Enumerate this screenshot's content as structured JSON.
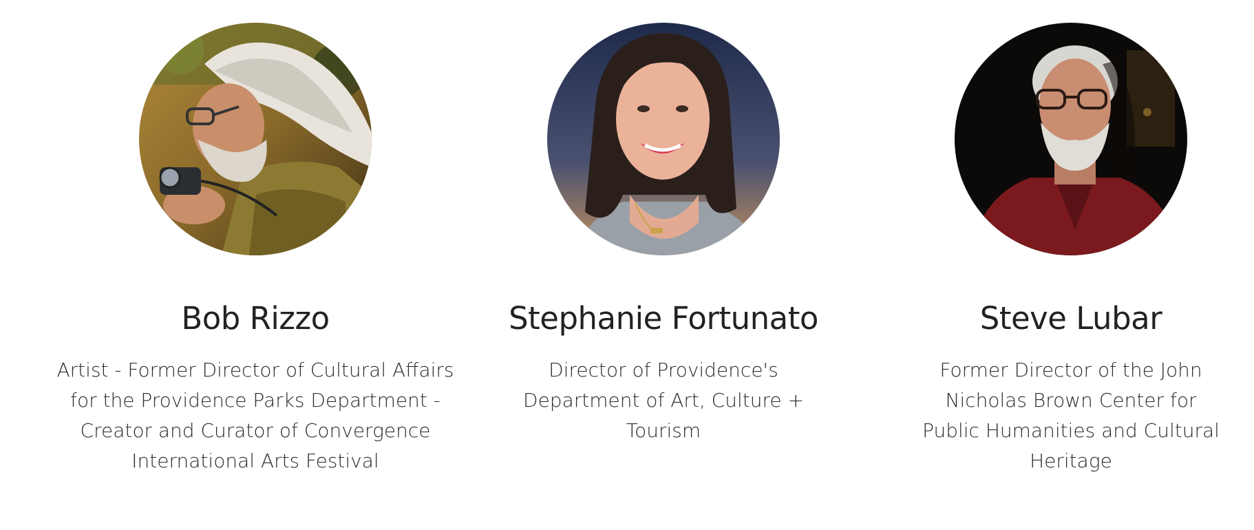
{
  "members": [
    {
      "name": "Bob Rizzo",
      "role_lines": [
        "Artist - Former Director of Cultural Affairs",
        "for the Providence Parks Department -",
        "Creator and Curator of Convergence",
        "International Arts Festival"
      ],
      "photo_icon": "portrait-photo"
    },
    {
      "name": "Stephanie Fortunato",
      "role_lines": [
        "Director of Providence's",
        "Department of Art, Culture +",
        "Tourism"
      ],
      "photo_icon": "portrait-photo"
    },
    {
      "name": "Steve Lubar",
      "role_lines": [
        "Former Director of the John",
        "Nicholas Brown Center for",
        "Public Humanities and Cultural",
        "Heritage"
      ],
      "photo_icon": "portrait-photo"
    }
  ],
  "colors": {
    "background": "#ffffff",
    "text": "#222222"
  }
}
